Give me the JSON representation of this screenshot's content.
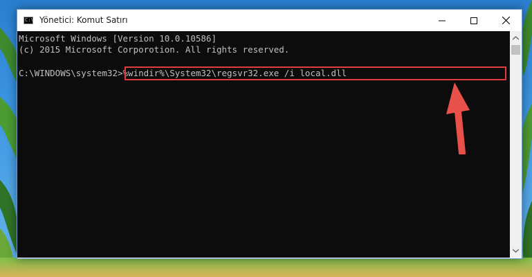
{
  "window": {
    "title": "Yönetici: Komut Satırı",
    "icon": "cmd-icon",
    "controls": {
      "minimize": "minimize-icon",
      "maximize": "maximize-icon",
      "close": "close-icon"
    }
  },
  "console": {
    "lines": [
      "Microsoft Windows [Version 10.0.10586]",
      "(c) 2015 Microsoft Corporotion. All rights reserved.",
      "",
      "C:\\WINDOWS\\system32>%windir%\\System32\\regsvr32.exe /i local.dll"
    ],
    "prompt": "C:\\WINDOWS\\system32>",
    "command": "%windir%\\System32\\regsvr32.exe /i local.dll"
  },
  "colors": {
    "highlight": "#e23c3c",
    "arrow": "#e8504a",
    "console_bg": "#0c0c0c",
    "console_text": "#c0c0c0"
  }
}
